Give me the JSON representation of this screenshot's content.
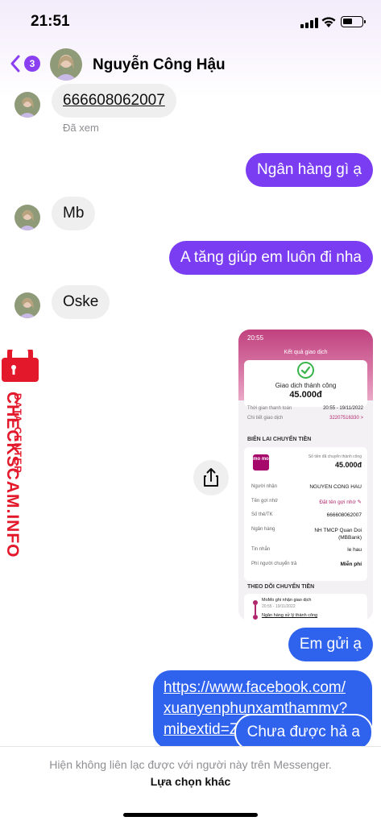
{
  "status_bar": {
    "time": "21:51"
  },
  "header": {
    "unread_count": "3",
    "contact_name": "Nguyễn Công Hậu"
  },
  "messages": [
    {
      "from": "them",
      "text": "666608062007"
    },
    {
      "from": "them",
      "meta": "Đã xem"
    },
    {
      "from": "me",
      "text": "Ngân hàng gì ạ"
    },
    {
      "from": "them",
      "text": "Mb"
    },
    {
      "from": "me",
      "text": "A tăng giúp em luôn đi nha"
    },
    {
      "from": "them",
      "text": "Oske"
    },
    {
      "from": "me",
      "text": "Em gửi ạ"
    },
    {
      "from": "me",
      "link_lines": [
        "https://www.facebook.com/",
        "xuanyenphunxamthammy?",
        "mibextid=Z"
      ]
    },
    {
      "from": "me",
      "text": "Chưa được hả a"
    }
  ],
  "screenshot_image": {
    "time": "20:55",
    "title": "Kết quả giao dịch",
    "status": "Giao dịch thành công",
    "amount": "45.000đ",
    "time_label": "Thời gian thanh toán",
    "time_value": "20:55 - 19/11/2022",
    "code_label": "Chi tiết giao dịch",
    "code_value": "32207516330 >",
    "receipt_title": "BIÊN LAI CHUYỂN TIỀN",
    "momo_logo": "mo mo",
    "sent_label": "Số tiền đã chuyển thành công",
    "sent_amount": "45.000đ",
    "rows": [
      {
        "label": "Người nhận",
        "value": "NGUYEN CONG HAU"
      },
      {
        "label": "Tên gợi nhớ",
        "value": "Đặt tên gợi nhớ ✎"
      },
      {
        "label": "Số thẻ/TK",
        "value": "666608062007"
      },
      {
        "label": "Ngân hàng",
        "value": "NH TMCP Quan Doi (MBBank)"
      },
      {
        "label": "Tin nhắn",
        "value": "le hau"
      },
      {
        "label": "Phí người chuyển trả",
        "value": "Miễn phí"
      }
    ],
    "track_title": "THEO DÕI CHUYỂN TIỀN",
    "track_1": "MoMo ghi nhận giao dịch",
    "track_1_time": "20:55 - 19/11/2022",
    "track_2": "Ngân hàng xử lý thành công"
  },
  "watermark": {
    "line1": "DATA CENTER",
    "line2": "CHECKSCAM.INFO"
  },
  "footer": {
    "notice": "Hiện không liên lạc được với người này trên Messenger.",
    "action": "Lựa chọn khác"
  },
  "colors": {
    "accent": "#7a3df2",
    "link_bubble": "#2f63ee",
    "incoming": "#efeff0",
    "watermark": "#e3192b"
  }
}
